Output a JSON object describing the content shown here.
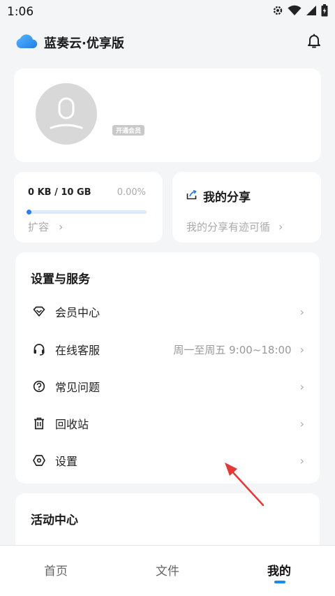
{
  "status_bar": {
    "time": "1:06"
  },
  "app": {
    "title": "蓝奏云·优享版"
  },
  "profile": {
    "vip_badge": "开通会员"
  },
  "storage": {
    "amount": "0 KB / 10 GB",
    "percent_text": "0.00%",
    "used_fraction": 0.0,
    "expand_label": "扩容"
  },
  "share": {
    "title": "我的分享",
    "subtitle": "我的分享有迹可循"
  },
  "settings": {
    "title": "设置与服务",
    "items": [
      {
        "label": "会员中心",
        "icon": "diamond-icon",
        "value": ""
      },
      {
        "label": "在线客服",
        "icon": "headset-icon",
        "value": "周一至周五 9:00~18:00"
      },
      {
        "label": "常见问题",
        "icon": "question-icon",
        "value": ""
      },
      {
        "label": "回收站",
        "icon": "trash-icon",
        "value": ""
      },
      {
        "label": "设置",
        "icon": "hexagon-settings-icon",
        "value": ""
      }
    ]
  },
  "activity": {
    "title": "活动中心"
  },
  "tabs": [
    {
      "label": "首页",
      "active": false
    },
    {
      "label": "文件",
      "active": false
    },
    {
      "label": "我的",
      "active": true
    }
  ],
  "colors": {
    "accent": "#2f7dea",
    "annotation_arrow": "#e53935"
  }
}
